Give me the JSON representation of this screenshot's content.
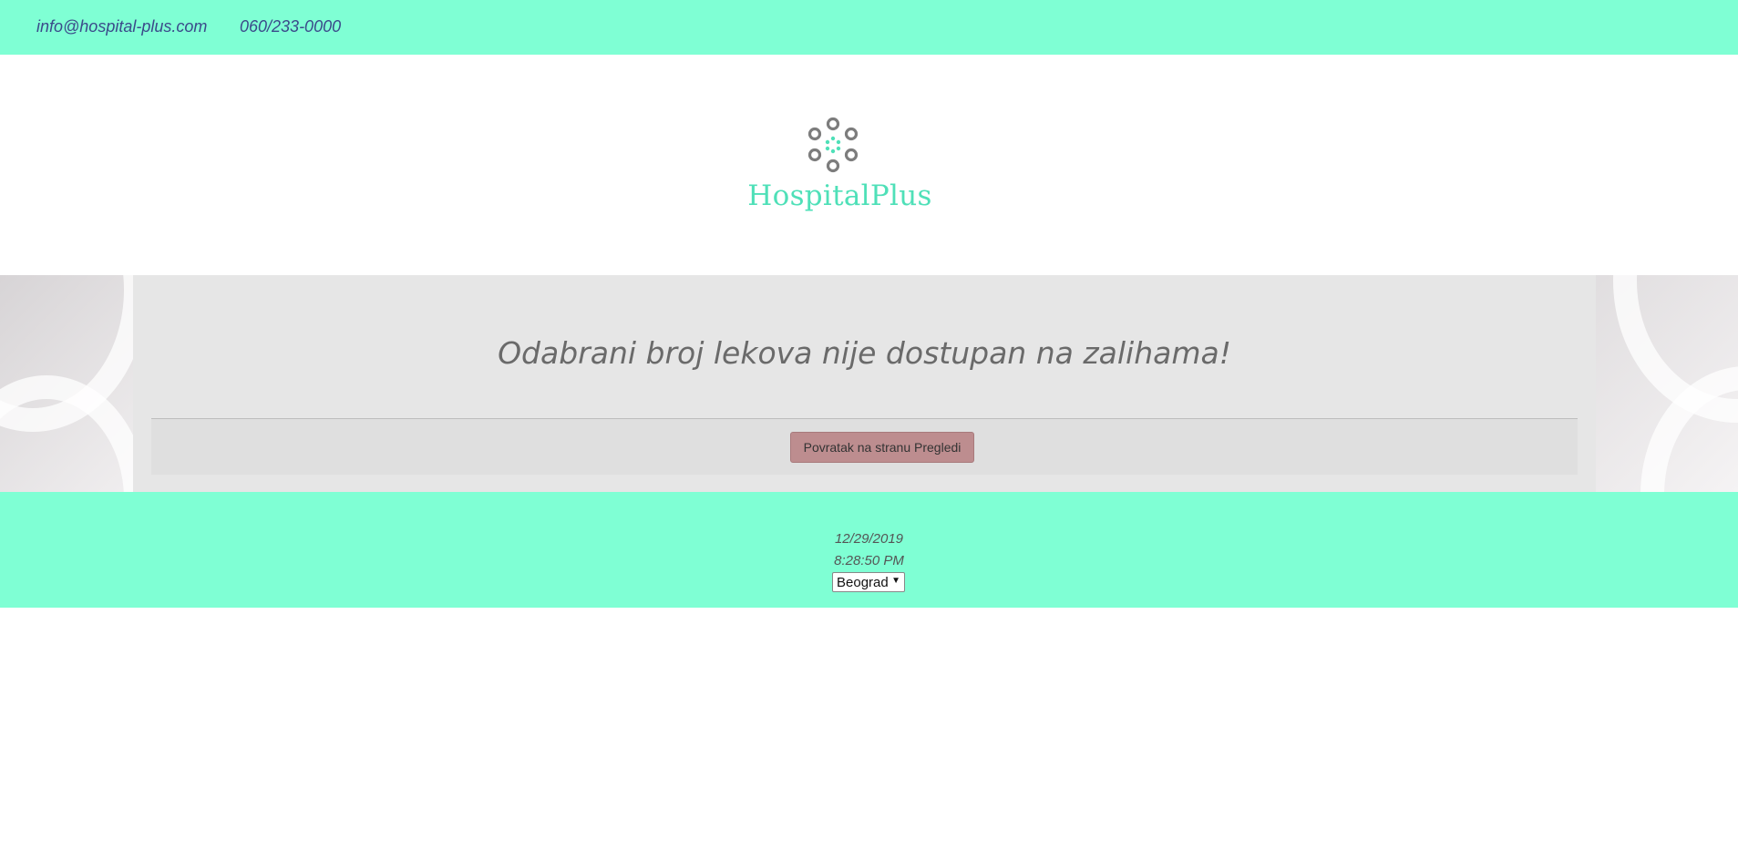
{
  "topbar": {
    "email": "info@hospital-plus.com",
    "phone": "060/233-0000"
  },
  "brand": {
    "name": "HospitalPlus",
    "logo_icon": "circle-cluster-icon",
    "color": "#4fe0b8"
  },
  "message": {
    "text": "Odabrani broj lekova nije dostupan na zalihama!"
  },
  "actions": {
    "back_label": "Povratak na stranu Pregledi"
  },
  "footer": {
    "date": "12/29/2019",
    "time": "8:28:50 PM",
    "city_selected": "Beograd"
  },
  "colors": {
    "accent": "#7fffd4",
    "button": "#bd8d8f"
  }
}
